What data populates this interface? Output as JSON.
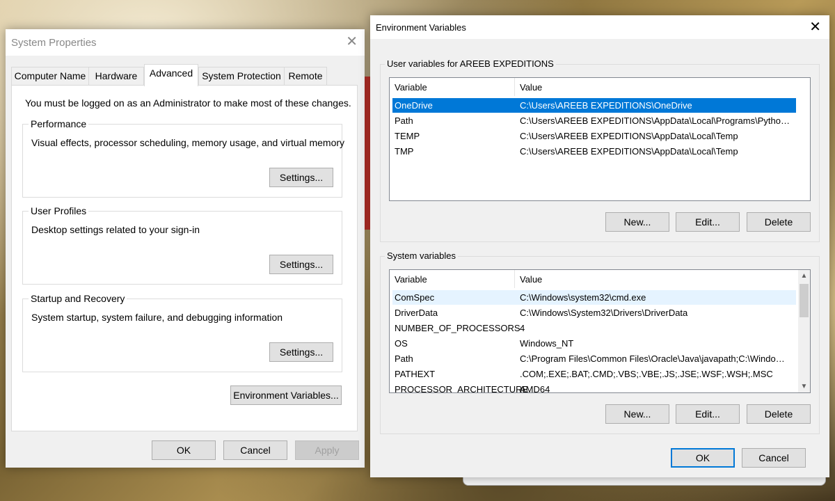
{
  "system_properties": {
    "title": "System Properties",
    "tabs": [
      "Computer Name",
      "Hardware",
      "Advanced",
      "System Protection",
      "Remote"
    ],
    "active_tab": "Advanced",
    "admin_note": "You must be logged on as an Administrator to make most of these changes.",
    "groups": [
      {
        "legend": "Performance",
        "description": "Visual effects, processor scheduling, memory usage, and virtual memory",
        "button": "Settings..."
      },
      {
        "legend": "User Profiles",
        "description": "Desktop settings related to your sign-in",
        "button": "Settings..."
      },
      {
        "legend": "Startup and Recovery",
        "description": "System startup, system failure, and debugging information",
        "button": "Settings..."
      }
    ],
    "env_button": "Environment Variables...",
    "ok": "OK",
    "cancel": "Cancel",
    "apply": "Apply"
  },
  "environment_variables": {
    "title": "Environment Variables",
    "user_section": {
      "legend": "User variables for AREEB EXPEDITIONS",
      "columns": [
        "Variable",
        "Value"
      ],
      "rows": [
        {
          "name": "OneDrive",
          "value": "C:\\Users\\AREEB EXPEDITIONS\\OneDrive",
          "selected": true
        },
        {
          "name": "Path",
          "value": "C:\\Users\\AREEB EXPEDITIONS\\AppData\\Local\\Programs\\Python\\Py..."
        },
        {
          "name": "TEMP",
          "value": "C:\\Users\\AREEB EXPEDITIONS\\AppData\\Local\\Temp"
        },
        {
          "name": "TMP",
          "value": "C:\\Users\\AREEB EXPEDITIONS\\AppData\\Local\\Temp"
        }
      ],
      "buttons": {
        "new": "New...",
        "edit": "Edit...",
        "delete": "Delete"
      }
    },
    "system_section": {
      "legend": "System variables",
      "columns": [
        "Variable",
        "Value"
      ],
      "rows": [
        {
          "name": "ComSpec",
          "value": "C:\\Windows\\system32\\cmd.exe",
          "hover": true
        },
        {
          "name": "DriverData",
          "value": "C:\\Windows\\System32\\Drivers\\DriverData"
        },
        {
          "name": "NUMBER_OF_PROCESSORS",
          "value": "4"
        },
        {
          "name": "OS",
          "value": "Windows_NT"
        },
        {
          "name": "Path",
          "value": "C:\\Program Files\\Common Files\\Oracle\\Java\\javapath;C:\\Windows..."
        },
        {
          "name": "PATHEXT",
          "value": ".COM;.EXE;.BAT;.CMD;.VBS;.VBE;.JS;.JSE;.WSF;.WSH;.MSC"
        },
        {
          "name": "PROCESSOR_ARCHITECTURE",
          "value": "AMD64"
        }
      ],
      "buttons": {
        "new": "New...",
        "edit": "Edit...",
        "delete": "Delete"
      }
    },
    "ok": "OK",
    "cancel": "Cancel"
  },
  "icons": {
    "close": "close-icon",
    "scroll_up": "chevron-up-icon",
    "scroll_down": "chevron-down-icon"
  },
  "colors": {
    "selection": "#0078d7",
    "hover_row": "#e5f3ff",
    "primary_border": "#0078d7"
  }
}
